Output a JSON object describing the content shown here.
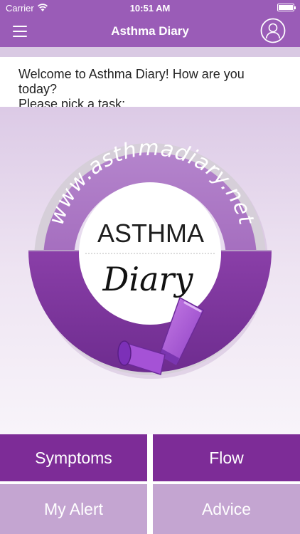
{
  "status_bar": {
    "carrier": "Carrier",
    "time": "10:51 AM"
  },
  "nav": {
    "title": "Asthma Diary",
    "menu_icon": "hamburger-icon",
    "profile_icon": "user-profile-icon"
  },
  "welcome": {
    "line1": "Welcome to Asthma Diary! How are you today?",
    "line2": "Please pick a task:"
  },
  "logo": {
    "url_text": "www.asthmadiary.net",
    "word_top": "ASTHMA",
    "word_bottom": "Diary"
  },
  "tiles": [
    {
      "label": "Symptoms"
    },
    {
      "label": "Flow"
    },
    {
      "label": "My Alert"
    },
    {
      "label": "Advice"
    }
  ],
  "colors": {
    "nav": "#9a5cb7",
    "tile_primary": "#7d2c97",
    "tile_secondary": "#c4a5d1"
  }
}
